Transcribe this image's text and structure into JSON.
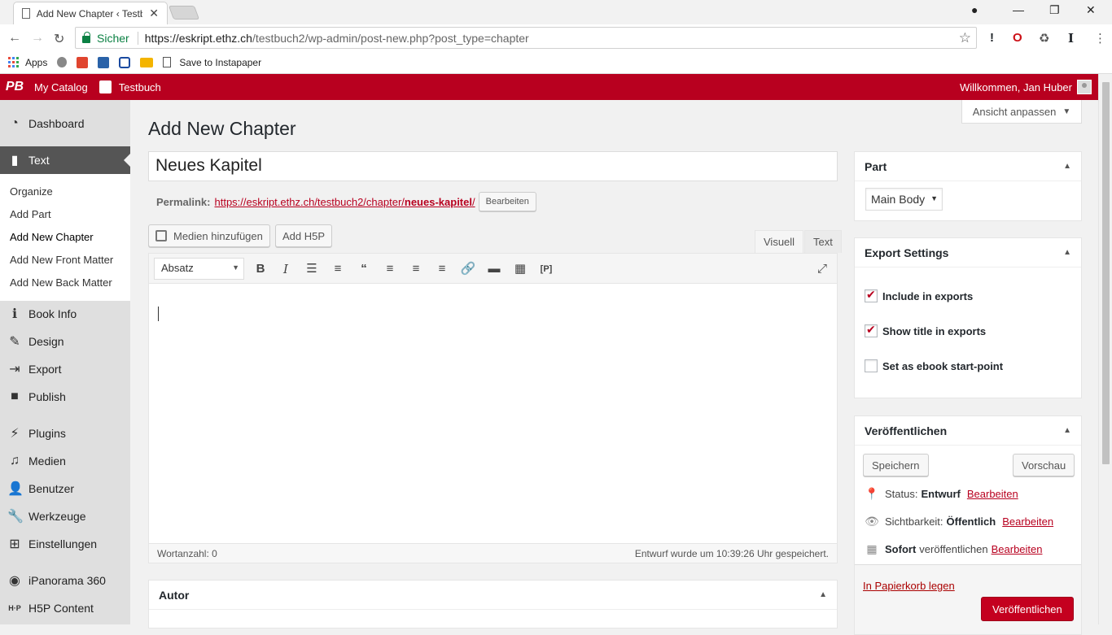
{
  "browser": {
    "tab_title": "Add New Chapter ‹ Testbuch",
    "secure_label": "Sicher",
    "url_host": "https://eskript.ethz.ch",
    "url_rest": "/testbuch2/wp-admin/post-new.php?post_type=chapter",
    "bookmarks": [
      "Apps",
      "Save to Instapaper"
    ]
  },
  "adminbar": {
    "logo": "PB",
    "my_catalog": "My Catalog",
    "book": "Testbuch",
    "welcome": "Willkommen, Jan Huber"
  },
  "sidebar": {
    "dashboard": "Dashboard",
    "text": "Text",
    "sub": [
      "Organize",
      "Add Part",
      "Add New Chapter",
      "Add New Front Matter",
      "Add New Back Matter"
    ],
    "book_info": "Book Info",
    "design": "Design",
    "export": "Export",
    "publish": "Publish",
    "plugins": "Plugins",
    "medien": "Medien",
    "benutzer": "Benutzer",
    "werkzeuge": "Werkzeuge",
    "einstellungen": "Einstellungen",
    "ipanorama": "iPanorama 360",
    "h5p": "H5P Content"
  },
  "main": {
    "screen_options": "Ansicht anpassen",
    "page_title": "Add New Chapter",
    "title_value": "Neues Kapitel",
    "permalink_label": "Permalink:",
    "permalink_url_pre": "https://eskript.ethz.ch/testbuch2/chapter/",
    "permalink_slug": "neues-kapitel",
    "permalink_url_post": "/",
    "permalink_edit": "Bearbeiten",
    "add_media": "Medien hinzufügen",
    "add_h5p": "Add H5P",
    "tab_visual": "Visuell",
    "tab_text": "Text",
    "format_select": "Absatz",
    "word_count": "Wortanzahl: 0",
    "autosave": "Entwurf wurde um 10:39:26 Uhr gespeichert.",
    "autor_title": "Autor"
  },
  "part_box": {
    "title": "Part",
    "selected": "Main Body"
  },
  "export_box": {
    "title": "Export Settings",
    "include": "Include in exports",
    "show_title": "Show title in exports",
    "start_point": "Set as ebook start-point"
  },
  "publish_box": {
    "title": "Veröffentlichen",
    "save": "Speichern",
    "preview": "Vorschau",
    "status_label": "Status:",
    "status_value": "Entwurf",
    "visibility_label": "Sichtbarkeit:",
    "visibility_value": "Öffentlich",
    "schedule_value": "Sofort",
    "schedule_label": "veröffentlichen",
    "edit": "Bearbeiten",
    "trash": "In Papierkorb legen",
    "publish": "Veröffentlichen"
  },
  "colors": {
    "brand": "#b8001f",
    "sidebar_active": "#555555"
  }
}
